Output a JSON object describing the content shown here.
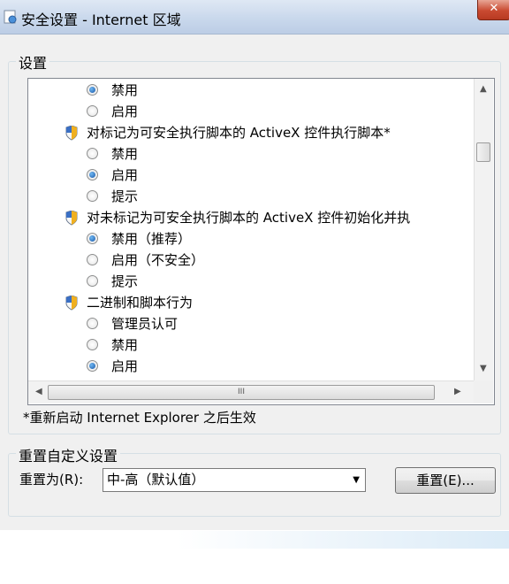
{
  "window": {
    "title": "安全设置 - Internet 区域",
    "close_glyph": "✕"
  },
  "settings_group": {
    "label": "设置",
    "items": [
      {
        "type": "radio",
        "label": "禁用",
        "selected": true
      },
      {
        "type": "radio",
        "label": "启用",
        "selected": false
      },
      {
        "type": "category",
        "label": "对标记为可安全执行脚本的 ActiveX 控件执行脚本*",
        "icon": "shield-icon"
      },
      {
        "type": "radio",
        "label": "禁用",
        "selected": false
      },
      {
        "type": "radio",
        "label": "启用",
        "selected": true
      },
      {
        "type": "radio",
        "label": "提示",
        "selected": false
      },
      {
        "type": "category",
        "label": "对未标记为可安全执行脚本的 ActiveX 控件初始化并执",
        "icon": "shield-icon"
      },
      {
        "type": "radio",
        "label": "禁用（推荐）",
        "selected": true
      },
      {
        "type": "radio",
        "label": "启用（不安全）",
        "selected": false
      },
      {
        "type": "radio",
        "label": "提示",
        "selected": false
      },
      {
        "type": "category",
        "label": "二进制和脚本行为",
        "icon": "shield-icon"
      },
      {
        "type": "radio",
        "label": "管理员认可",
        "selected": false
      },
      {
        "type": "radio",
        "label": "禁用",
        "selected": false
      },
      {
        "type": "radio",
        "label": "启用",
        "selected": true
      }
    ],
    "hscroll_grip": "III"
  },
  "note": "*重新启动 Internet Explorer 之后生效",
  "reset_group": {
    "label": "重置自定义设置",
    "reset_to_label": "重置为(R):",
    "select_value": "中-高（默认值）",
    "reset_button": "重置(E)..."
  },
  "colors": {
    "titlebar": "#c9d8ec",
    "close": "#c94a31",
    "radio_selected": "#1a57a8",
    "shield": "#f0b020"
  }
}
